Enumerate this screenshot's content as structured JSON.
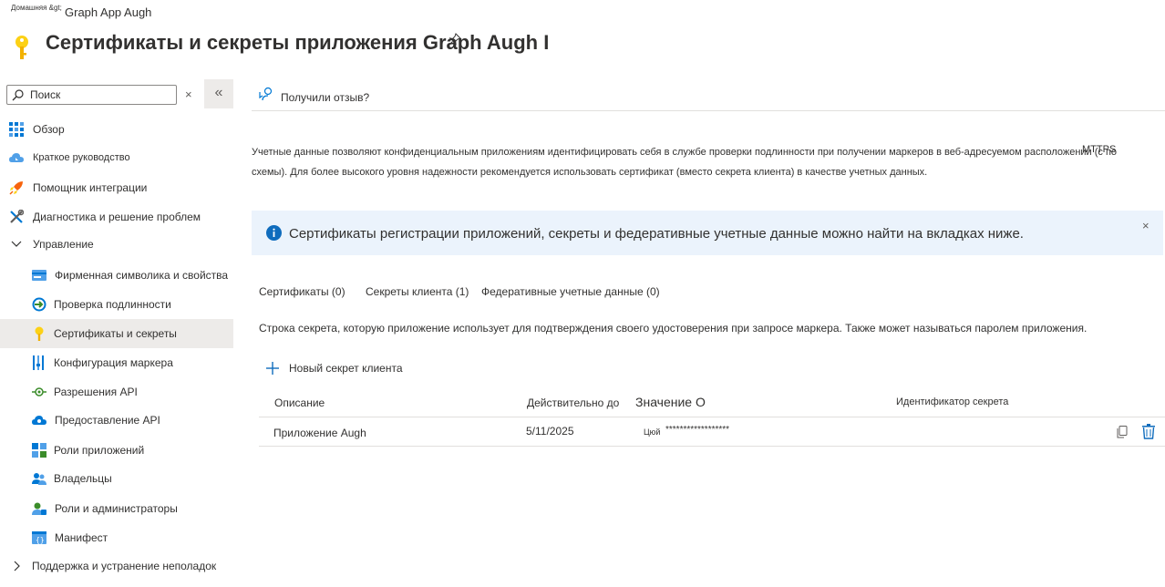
{
  "breadcrumb": {
    "home": "Домашняя &gt;",
    "app": "Graph App Augh"
  },
  "page": {
    "title": "Сертификаты и секреты приложения Graph Augh I"
  },
  "sidebar": {
    "search_placeholder": "Поиск",
    "collapse": "«",
    "clear": "×",
    "items": [
      {
        "label": "Обзор",
        "icon": "overview-grid-icon"
      },
      {
        "label": "Краткое руководство",
        "icon": "cloud-quickstart-icon"
      },
      {
        "label": "Помощник интеграции",
        "icon": "rocket-icon"
      },
      {
        "label": "Диагностика и решение проблем",
        "icon": "tools-icon"
      },
      {
        "label": "Управление",
        "icon": "chevron-down-icon"
      },
      {
        "label": "Фирменная символика и свойства",
        "icon": "branding-card-icon"
      },
      {
        "label": "Проверка подлинности",
        "icon": "authentication-icon"
      },
      {
        "label": "Сертификаты и секреты",
        "icon": "key-icon"
      },
      {
        "label": "Конфигурация маркера",
        "icon": "token-bars-icon"
      },
      {
        "label": "Разрешения API",
        "icon": "api-permissions-icon"
      },
      {
        "label": "Предоставление API",
        "icon": "cloud-api-icon"
      },
      {
        "label": "Роли приложений",
        "icon": "app-roles-icon"
      },
      {
        "label": "Владельцы",
        "icon": "owners-icon"
      },
      {
        "label": "Роли и администраторы",
        "icon": "roles-admins-icon"
      },
      {
        "label": "Манифест",
        "icon": "manifest-icon"
      },
      {
        "label": "Поддержка и устранение неполадок",
        "icon": "chevron-right-icon"
      }
    ]
  },
  "toolbar": {
    "feedback": "Получили отзыв?"
  },
  "description": {
    "line1": "Учетные данные позволяют конфиденциальным приложениям идентифицировать себя в службе проверки подлинности при получении маркеров в веб-адресуемом расположении (с по",
    "line2": "схемы). Для более высокого уровня надежности рекомендуется использовать сертификат (вместо секрета клиента) в качестве учетных данных.",
    "more": "МТТPS"
  },
  "info_bar": {
    "text": "Сертификаты регистрации приложений, секреты и федеративные учетные данные можно найти на вкладках ниже.",
    "close": "×"
  },
  "tabs": [
    {
      "label": "Сертификаты (0)"
    },
    {
      "label": "Секреты клиента (1)"
    },
    {
      "label": "Федеративные учетные данные (0)"
    }
  ],
  "secrets": {
    "description": "Строка секрета, которую приложение использует для подтверждения своего удостоверения при запросе маркера. Также может называться паролем приложения.",
    "new_button": "Новый секрет клиента",
    "columns": {
      "description": "Описание",
      "expires": "Действительно до",
      "value": "Значение О",
      "secret_id": "Идентификатор секрета"
    },
    "rows": [
      {
        "description": "Приложение Augh",
        "expires": "5/11/2025",
        "value_prefix": "Цюй",
        "value": "******************",
        "secret_id": ""
      }
    ]
  },
  "colors": {
    "accent": "#0f6cbd",
    "selected_bg": "#edebe9",
    "info_bg": "#ebf3fc",
    "key": "#fcd116"
  }
}
